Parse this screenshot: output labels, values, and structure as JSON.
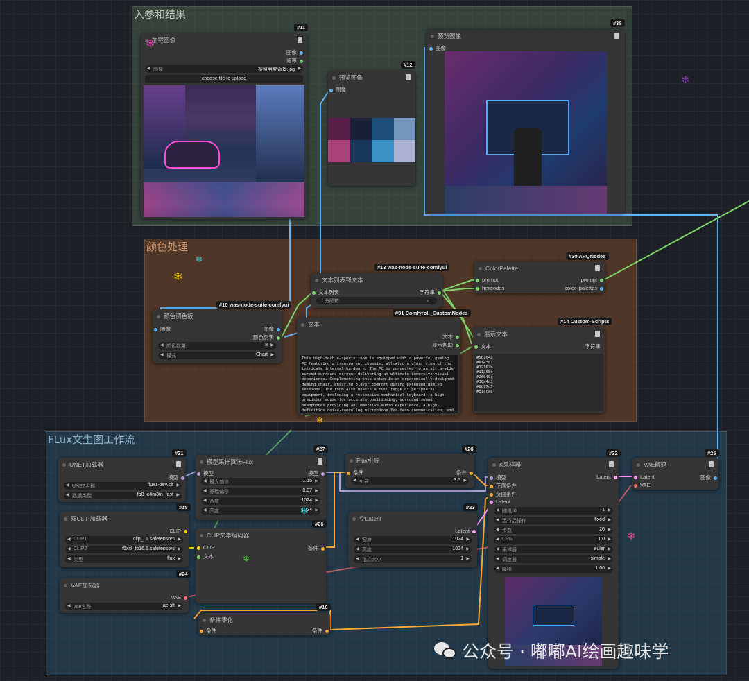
{
  "groups": {
    "io": "入参和结果",
    "color": "颜色处理",
    "flux": "FLux文生图工作流"
  },
  "nodes": {
    "load_image": {
      "id": "#11",
      "title": "加载图像",
      "out_image": "图像",
      "out_mask": "遮罩",
      "image_label": "图像",
      "image_value": "赛博朋克背景.jpg",
      "upload": "choose file to upload"
    },
    "preview12": {
      "id": "#12",
      "title": "预览图像",
      "in_image": "图像",
      "swatches": [
        "#5b1d4a",
        "#1a1f38",
        "#1d4e7a",
        "#7496bd",
        "#a8437b",
        "#17365a",
        "#3b8fc5",
        "#aab0cf"
      ]
    },
    "preview36": {
      "id": "#36",
      "title": "预览图像",
      "in_image": "图像"
    },
    "palette10": {
      "id": "#10 was-node-suite-comfyui",
      "title": "颜色调色板",
      "in_image": "图像",
      "out_image": "图像",
      "out_colors": "颜色列表",
      "count_label": "颜色数量",
      "count_value": "8",
      "mode_label": "模式",
      "mode_value": "Chart"
    },
    "list_to_text13": {
      "id": "#13 was-node-suite-comfyui",
      "title": "文本列表到文本",
      "in_list": "文本列表",
      "out_str": "字符串",
      "delimiter": "分隔符",
      "delimiter_value": ","
    },
    "text31": {
      "id": "#31 Comfyroll_CustomNodes",
      "title": "文本",
      "out_text": "文本",
      "out_help": "显示帮助",
      "body": "This high-tech e-sports room is equipped with a powerful gaming PC featuring a transparent chassis, allowing a clear view of the intricate internal hardware. The PC is connected to an ultra-wide curved surround screen, delivering an ultimate immersive visual experience. Complementing this setup is an ergonomically designed gaming chair, ensuring player comfort during extended gaming sessions. The room also boasts a full range of peripheral equipment, including a responsive mechanical keyboard, a high-precision mouse for accurate positioning, surround sound headphones providing an immersive audio experience, a high-definition noise-canceling microphone for team communication, and an HD webcam for live streaming. Additionally, the room features an adjustable smart"
    },
    "colorpalette30": {
      "id": "#30 APQNodes",
      "title": "ColorPalette",
      "in_prompt": "prompt",
      "in_hex": "hexcodes",
      "out_prompt": "prompt",
      "out_palettes": "color_palettes"
    },
    "showtext14": {
      "id": "#14 Custom-Scripts",
      "title": "展示文本",
      "in_text": "文本",
      "out_str": "字符串",
      "lines": [
        "#5b1d4a",
        "#af4381",
        "#12162b",
        "#11355f",
        "#26649e",
        "#38a4d3",
        "#8b97d5",
        "#d1cce6"
      ]
    },
    "unet21": {
      "id": "#21",
      "title": "UNET加载器",
      "out_model": "模型",
      "name_label": "UNET名称",
      "name_value": "flux1-dev.sft",
      "dtype_label": "数据类型",
      "dtype_value": "fp8_e4m3fn_fast"
    },
    "sampling27": {
      "id": "#27",
      "title": "模型采样算法Flux",
      "in_model": "模型",
      "out_model": "模型",
      "max_shift_label": "最大偏移",
      "max_shift": "1.15",
      "base_shift_label": "基础偏移",
      "base_shift": "0.07",
      "width_label": "宽度",
      "width": "1024",
      "height_label": "高度",
      "height": "1024"
    },
    "guidance28": {
      "id": "#28",
      "title": "Flux引导",
      "in_cond": "条件",
      "out_cond": "条件",
      "guide_label": "引导",
      "guide_value": "3.5"
    },
    "ksampler22": {
      "id": "#22",
      "title": "K采样器",
      "in_model": "模型",
      "in_pos": "正面条件",
      "in_neg": "负面条件",
      "in_latent": "Latent",
      "out_latent": "Latent",
      "seed_label": "随机种",
      "seed": "1",
      "after_label": "运行后操作",
      "after": "fixed",
      "steps_label": "步数",
      "steps": "20",
      "cfg_label": "CFG",
      "cfg": "1.0",
      "sampler_label": "采样器",
      "sampler": "euler",
      "sched_label": "调度器",
      "sched": "simple",
      "denoise_label": "降噪",
      "denoise": "1.00"
    },
    "vaedecode25": {
      "id": "#25",
      "title": "VAE解码",
      "in_latent": "Latent",
      "in_vae": "VAE",
      "out_image": "图像"
    },
    "dualclip15": {
      "id": "#15",
      "title": "双CLIP加载器",
      "out_clip": "CLIP",
      "clip1_label": "CLIP1",
      "clip1": "clip_l.1.safetensors",
      "clip2_label": "CLIP2",
      "clip2": "t5xxl_fp16.1.safetensors",
      "type_label": "类型",
      "type": "flux"
    },
    "clipencode26": {
      "id": "#26",
      "title": "CLIP文本编码器",
      "in_clip": "CLIP",
      "in_text": "文本",
      "out_cond": "条件"
    },
    "latent23": {
      "id": "#23",
      "title": "空Latent",
      "out_latent": "Latent",
      "width_label": "宽度",
      "width": "1024",
      "height_label": "高度",
      "height": "1024",
      "batch_label": "批次大小",
      "batch": "1"
    },
    "vae24": {
      "id": "#24",
      "title": "VAE加载器",
      "out_vae": "VAE",
      "name_label": "vae名称",
      "name": "ae.sft"
    },
    "zero16": {
      "id": "#16",
      "title": "条件零化",
      "in_cond": "条件",
      "out_cond": "条件"
    }
  },
  "watermark": "公众号 · 嘟嘟AI绘画趣味学"
}
